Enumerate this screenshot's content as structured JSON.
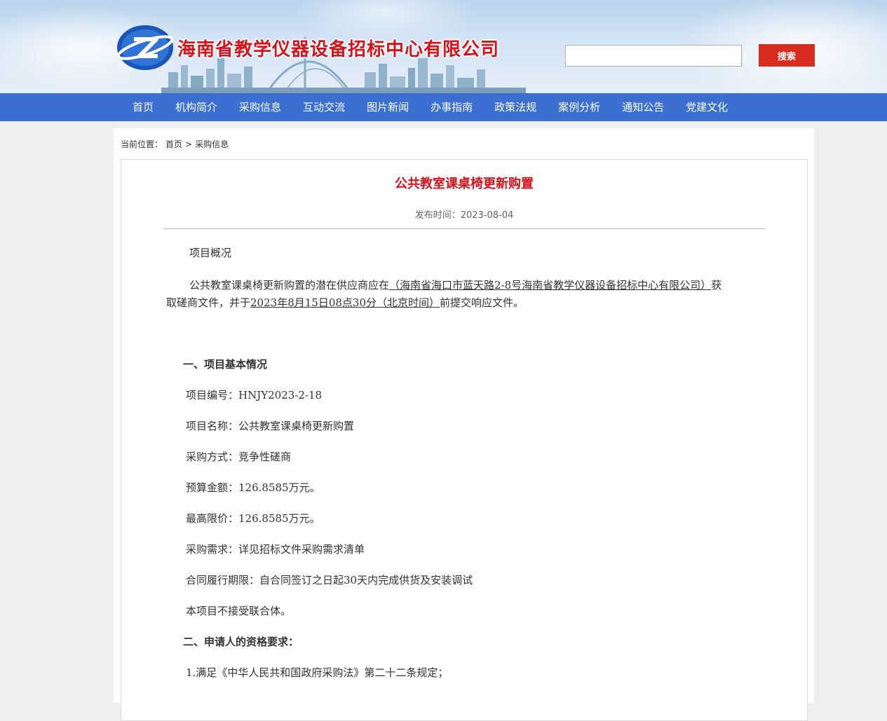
{
  "header": {
    "site_name": "海南省教学仪器设备招标中心有限公司",
    "search_placeholder": "",
    "search_button": "搜索"
  },
  "nav": {
    "items": [
      "首页",
      "机构简介",
      "采购信息",
      "互动交流",
      "图片新闻",
      "办事指南",
      "政策法规",
      "案例分析",
      "通知公告",
      "党建文化"
    ]
  },
  "breadcrumb": {
    "prefix": "当前位置：",
    "home": "首页",
    "sep": ">",
    "current": "采购信息"
  },
  "article": {
    "title": "公共教室课桌椅更新购置",
    "date": "发布时间：2023-08-04",
    "overview_label": "项目概况",
    "intro_part1": "公共教室课桌椅更新购置的潜在供应商应在",
    "intro_link1": "（海南省海口市蓝天路2-8号海南省教学仪器设备招标中心有限公司）",
    "intro_part2": "获",
    "intro_line2_a": "取磋商文件，并于",
    "intro_link2": "2023年8月15日08点30分（北京时间）",
    "intro_line2_b": "前提交响应文件。",
    "section1_heading": "一、项目基本情况",
    "project_no": "项目编号：HNJY2023-2-18",
    "project_name": "项目名称：公共教室课桌椅更新购置",
    "method": "采购方式：竞争性磋商",
    "budget": "预算金额：126.8585万元。",
    "max_price": "最高限价：126.8585万元。",
    "demand": "采购需求：详见招标文件采购需求清单",
    "contract_period": "合同履行期限：自合同签订之日起30天内完成供货及安装调试",
    "consortium": "本项目不接受联合体。",
    "section2_heading": "二、申请人的资格要求：",
    "req1": "1.满足《中华人民共和国政府采购法》第二十二条规定；"
  },
  "colors": {
    "nav_bg": "#3b6fd1",
    "title_red": "#d8121b",
    "search_button": "#d82c1e"
  }
}
